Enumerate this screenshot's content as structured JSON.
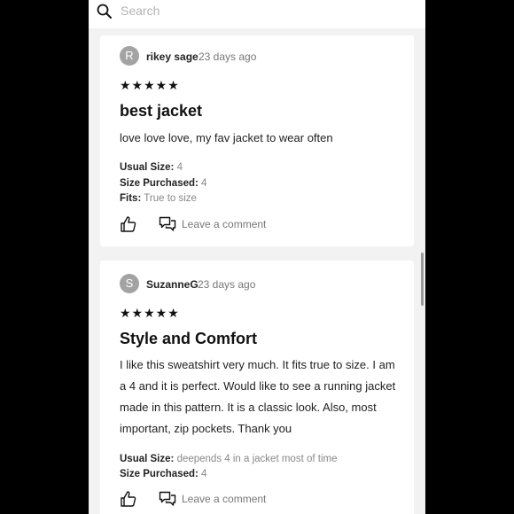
{
  "search": {
    "placeholder": "Search"
  },
  "reviews": [
    {
      "avatar_letter": "R",
      "author": "rikey sage",
      "date": "23 days ago",
      "stars": "★★★★★",
      "title": "best jacket",
      "body": "love love love, my fav jacket to wear often",
      "fields": [
        {
          "label": "Usual Size:",
          "value": "4"
        },
        {
          "label": "Size Purchased:",
          "value": "4"
        },
        {
          "label": "Fits:",
          "value": "True to size"
        }
      ],
      "comment_label": "Leave a comment"
    },
    {
      "avatar_letter": "S",
      "author": "SuzanneG",
      "date": "23 days ago",
      "stars": "★★★★★",
      "title": "Style and Comfort",
      "body": "I like this sweatshirt very much. It fits true to size. I am a 4 and it is perfect. Would like to see a running jacket made in this pattern. It is a classic look. Also, most important, zip pockets. Thank you",
      "fields": [
        {
          "label": "Usual Size:",
          "value": "deepends 4 in a jacket most of time"
        },
        {
          "label": "Size Purchased:",
          "value": "4"
        }
      ],
      "comment_label": "Leave a comment"
    }
  ]
}
